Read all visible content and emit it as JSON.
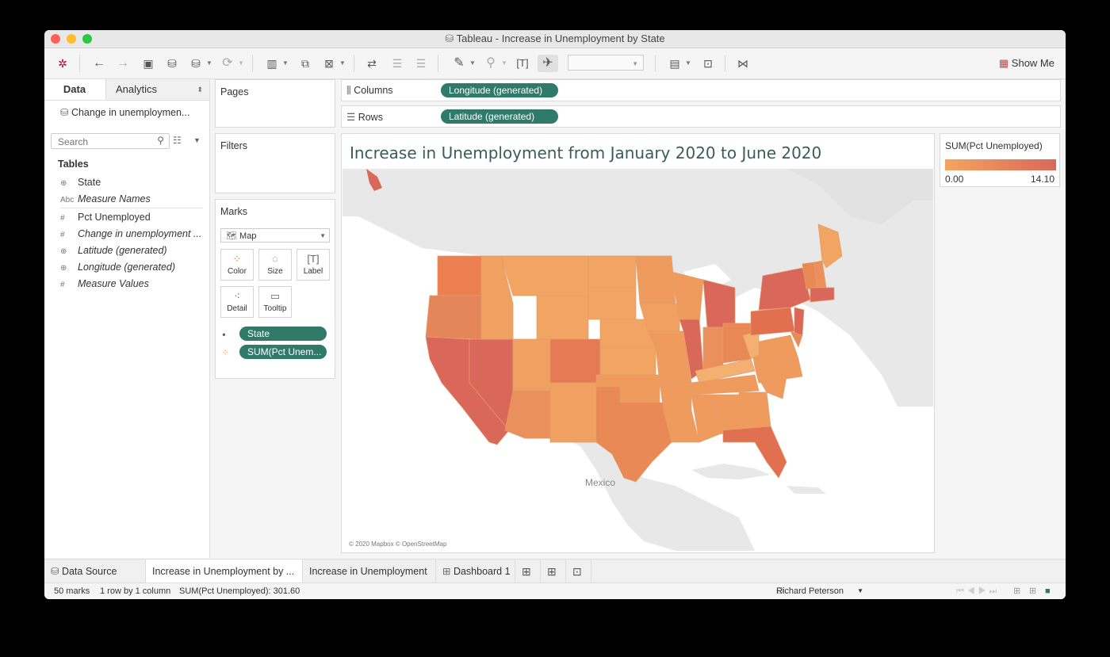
{
  "window": {
    "title": "Tableau - Increase in Unemployment by State"
  },
  "toolbar": {
    "show_me_label": "Show Me"
  },
  "left_pane": {
    "tabs": {
      "data": "Data",
      "analytics": "Analytics"
    },
    "data_source": "Change in unemploymen...",
    "search_placeholder": "Search",
    "tables_heading": "Tables",
    "fields": [
      {
        "type": "geo",
        "label": "State"
      },
      {
        "type": "Abc",
        "label": "Measure Names"
      },
      {
        "type": "#",
        "label": "Pct Unemployed"
      },
      {
        "type": "#",
        "label": "Change in unemployment ..."
      },
      {
        "type": "geo",
        "label": "Latitude (generated)"
      },
      {
        "type": "geo",
        "label": "Longitude (generated)"
      },
      {
        "type": "#",
        "label": "Measure Values"
      }
    ]
  },
  "pages": {
    "label": "Pages"
  },
  "filters": {
    "label": "Filters"
  },
  "marks": {
    "label": "Marks",
    "type": "Map",
    "buttons": {
      "color": "Color",
      "size": "Size",
      "label": "Label",
      "detail": "Detail",
      "tooltip": "Tooltip"
    },
    "pills": [
      "State",
      "SUM(Pct Unem..."
    ]
  },
  "shelves": {
    "columns_label": "Columns",
    "columns_pill": "Longitude (generated)",
    "rows_label": "Rows",
    "rows_pill": "Latitude (generated)"
  },
  "viz": {
    "title": "Increase in Unemployment from January 2020 to June 2020",
    "map_label": "Mexico",
    "attribution": "© 2020 Mapbox © OpenStreetMap"
  },
  "legend": {
    "title": "SUM(Pct Unemployed)",
    "min": "0.00",
    "max": "14.10",
    "color_low": "#f4a460",
    "color_high": "#d9685a"
  },
  "sheet_tabs": {
    "data_source": "Data Source",
    "tabs": [
      "Increase in Unemployment by ...",
      "Increase in Unemployment",
      "Dashboard 1"
    ]
  },
  "status": {
    "marks": "50 marks",
    "rows_cols": "1 row by 1 column",
    "sum": "SUM(Pct Unemployed): 301.60",
    "user": "Richard Peterson"
  }
}
